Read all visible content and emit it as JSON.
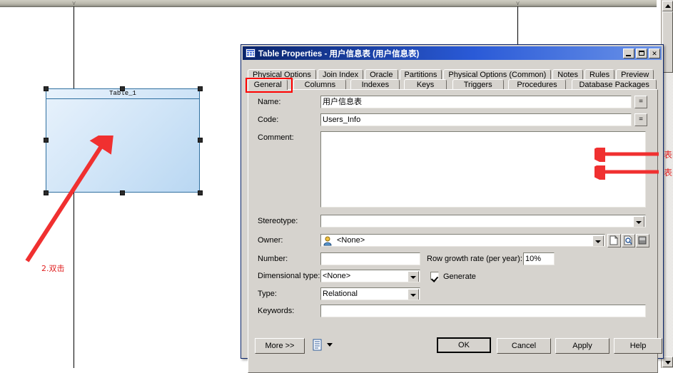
{
  "canvas": {
    "table_symbol": {
      "name": "Table_1"
    },
    "annotation": {
      "label": "2.双击"
    },
    "scrollbar": {
      "up_icon": "scroll-up-arrow",
      "down_icon": "scroll-down-arrow"
    }
  },
  "dialog": {
    "title": "Table Properties - 用户信息表 (用户信息表)",
    "icon": "table-icon",
    "window_buttons": {
      "minimize": "minimize-icon",
      "maximize": "maximize-icon",
      "close": "✕"
    },
    "tabs_row1": [
      "Physical Options",
      "Join Index",
      "Oracle",
      "Partitions",
      "Physical Options (Common)",
      "Notes",
      "Rules",
      "Preview"
    ],
    "tabs_row2": [
      "General",
      "Columns",
      "Indexes",
      "Keys",
      "Triggers",
      "Procedures",
      "Database Packages"
    ],
    "selected_tab": "General",
    "fields": {
      "name": {
        "label": "Name:",
        "value": "用户信息表",
        "equals_button": "="
      },
      "code": {
        "label": "Code:",
        "value": "Users_Info",
        "equals_button": "="
      },
      "comment": {
        "label": "Comment:",
        "value": ""
      },
      "stereotype": {
        "label": "Stereotype:",
        "value": ""
      },
      "owner": {
        "label": "Owner:",
        "value": "<None>",
        "icon": "user-icon",
        "buttons": [
          "create-icon",
          "properties-icon",
          "delete-icon"
        ]
      },
      "number": {
        "label": "Number:",
        "value": ""
      },
      "row_growth": {
        "label": "Row growth rate (per year):",
        "value": "10%"
      },
      "dimensional_type": {
        "label": "Dimensional type:",
        "value": "<None>"
      },
      "generate": {
        "label": "Generate",
        "checked": true
      },
      "type": {
        "label": "Type:",
        "value": "Relational"
      },
      "keywords": {
        "label": "Keywords:",
        "value": ""
      }
    },
    "annotations": {
      "name_note": "表昵名",
      "code_note": "表名"
    },
    "buttons": {
      "more": "More >>",
      "print": "print-icon",
      "print_dropdown": "chevron-down-icon",
      "ok": "OK",
      "cancel": "Cancel",
      "apply": "Apply",
      "help": "Help"
    }
  },
  "colors": {
    "accent_red": "#e02020",
    "title_blue": "#0a246a",
    "dialog_face": "#d6d3ce",
    "table_fill": "#cfe4f7",
    "table_border": "#2f6f9f"
  }
}
